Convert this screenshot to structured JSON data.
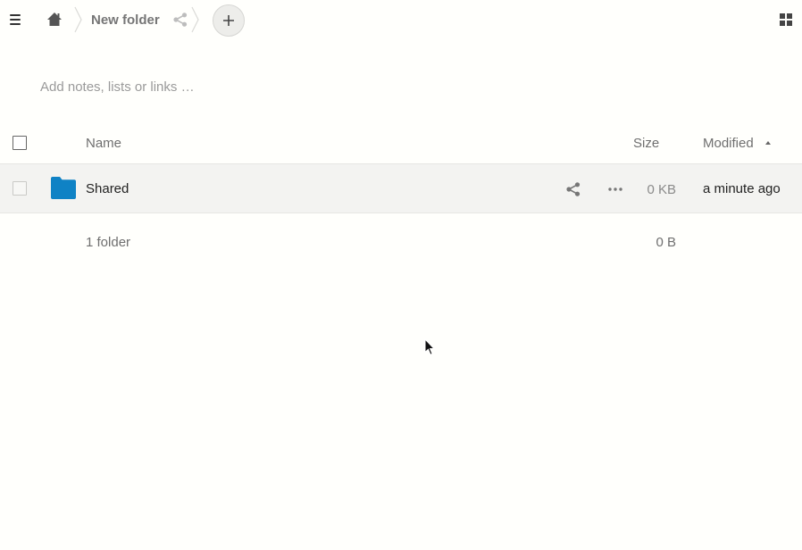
{
  "breadcrumb": {
    "home_icon": "home-icon",
    "current_folder": "New folder",
    "share_icon": "share-icon"
  },
  "toolbar": {
    "menu_icon": "hamburger-menu-icon",
    "new_icon": "plus-icon",
    "view_icon": "grid-view-icon"
  },
  "notes": {
    "placeholder": "Add notes, lists or links …"
  },
  "table": {
    "columns": {
      "name": "Name",
      "size": "Size",
      "modified": "Modified"
    },
    "sort": {
      "column": "Modified",
      "direction": "ascending"
    },
    "rows": [
      {
        "type": "folder",
        "name": "Shared",
        "size": "0 KB",
        "modified": "a minute ago"
      }
    ],
    "summary": {
      "count": "1 folder",
      "size": "0 B"
    }
  },
  "colors": {
    "folder": "#0f82c5",
    "background": "#fffffc",
    "row_hover": "#f3f3f1"
  }
}
